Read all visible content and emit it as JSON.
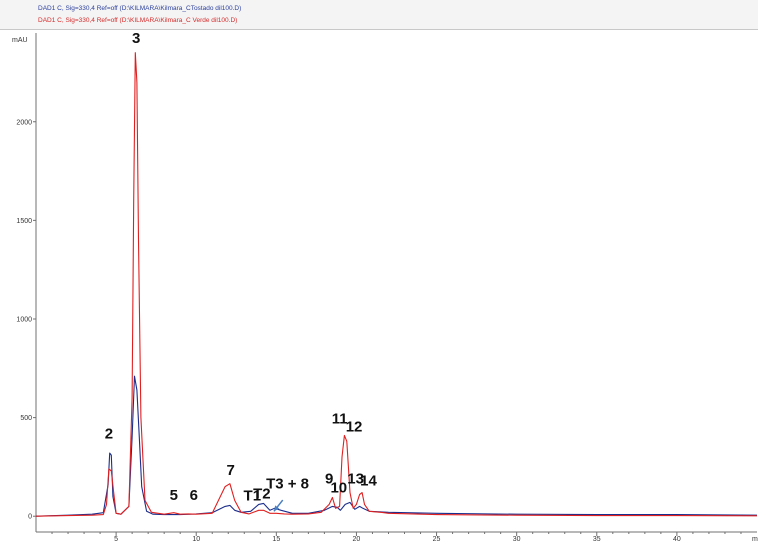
{
  "legend": {
    "blue_label": "DAD1 C, Sig=330,4 Ref=off (D:\\KILMARA\\Kilmara_CTostado dil100.D)",
    "red_label": "DAD1 C, Sig=330,4 Ref=off (D:\\KILMARA\\Kilmara_C Verde dil100.D)"
  },
  "chart_data": {
    "type": "line",
    "title": "",
    "ylabel": "mAU",
    "xlabel": "",
    "x_unit_label": "mi",
    "xlim": [
      0,
      45
    ],
    "ylim": [
      -80,
      2450
    ],
    "x_ticks": [
      5,
      10,
      15,
      20,
      25,
      30,
      35,
      40
    ],
    "y_ticks": [
      0,
      500,
      1000,
      1500,
      2000
    ],
    "grid": false,
    "colors": {
      "blue": "#1c2e8c",
      "red": "#e02020",
      "axis": "#707070"
    },
    "series": [
      {
        "color": "#1c2e8c",
        "x": [
          0,
          2,
          3.5,
          4.2,
          4.5,
          4.6,
          4.7,
          4.8,
          5.0,
          5.3,
          5.8,
          6.0,
          6.15,
          6.3,
          6.45,
          6.6,
          6.9,
          7.3,
          8,
          9,
          10,
          11,
          11.8,
          12.1,
          12.4,
          12.8,
          13.4,
          13.9,
          14.2,
          14.6,
          14.9,
          15.3,
          16,
          17,
          18,
          18.5,
          18.8,
          19.0,
          19.3,
          19.6,
          19.9,
          20.2,
          20.4,
          20.8,
          22,
          25,
          30,
          35,
          40,
          45
        ],
        "y": [
          0,
          5,
          10,
          18,
          160,
          320,
          310,
          100,
          15,
          10,
          50,
          400,
          710,
          640,
          400,
          150,
          25,
          10,
          8,
          8,
          12,
          18,
          50,
          55,
          30,
          20,
          25,
          60,
          65,
          30,
          40,
          30,
          15,
          15,
          30,
          50,
          45,
          30,
          60,
          70,
          35,
          50,
          40,
          25,
          20,
          15,
          10,
          8,
          8,
          5
        ]
      },
      {
        "color": "#e02020",
        "x": [
          0,
          2,
          3.5,
          4.2,
          4.4,
          4.55,
          4.7,
          4.85,
          5.0,
          5.3,
          5.8,
          6.0,
          6.1,
          6.2,
          6.3,
          6.4,
          6.55,
          6.8,
          7.2,
          8,
          8.6,
          9,
          9.5,
          10,
          11,
          11.8,
          12.1,
          12.4,
          12.8,
          13.3,
          13.9,
          14.2,
          14.6,
          15,
          15.5,
          16,
          17,
          17.8,
          18.3,
          18.5,
          18.7,
          18.95,
          19.1,
          19.25,
          19.4,
          19.6,
          19.8,
          20.0,
          20.2,
          20.35,
          20.5,
          20.8,
          21.5,
          22,
          25,
          30,
          35,
          40,
          45
        ],
        "y": [
          0,
          3,
          5,
          8,
          60,
          240,
          230,
          120,
          15,
          10,
          50,
          600,
          1600,
          2350,
          2200,
          1400,
          500,
          80,
          20,
          10,
          18,
          10,
          12,
          10,
          15,
          150,
          165,
          80,
          20,
          12,
          30,
          30,
          15,
          15,
          12,
          10,
          12,
          20,
          60,
          95,
          40,
          50,
          300,
          410,
          380,
          120,
          40,
          60,
          110,
          120,
          60,
          25,
          20,
          15,
          8,
          5,
          3,
          3,
          2
        ]
      }
    ],
    "annotations": [
      {
        "text": "2",
        "x": 4.55,
        "y": 395
      },
      {
        "text": "3",
        "x": 6.25,
        "y": 2400
      },
      {
        "text": "5",
        "x": 8.6,
        "y": 82
      },
      {
        "text": "6",
        "x": 9.85,
        "y": 82
      },
      {
        "text": "7",
        "x": 12.15,
        "y": 210
      },
      {
        "text": "T1",
        "x": 13.5,
        "y": 80
      },
      {
        "text": "T2",
        "x": 14.1,
        "y": 90
      },
      {
        "text": "T3 + 8",
        "x": 15.7,
        "y": 140
      },
      {
        "text": "9",
        "x": 18.3,
        "y": 165
      },
      {
        "text": "10",
        "x": 18.9,
        "y": 120
      },
      {
        "text": "11",
        "x": 18.95,
        "y": 470
      },
      {
        "text": "12",
        "x": 19.85,
        "y": 430
      },
      {
        "text": "13",
        "x": 19.95,
        "y": 165
      },
      {
        "text": "14",
        "x": 20.75,
        "y": 155
      }
    ],
    "arrow": {
      "from": [
        15.4,
        82
      ],
      "to": [
        14.85,
        25
      ]
    }
  }
}
